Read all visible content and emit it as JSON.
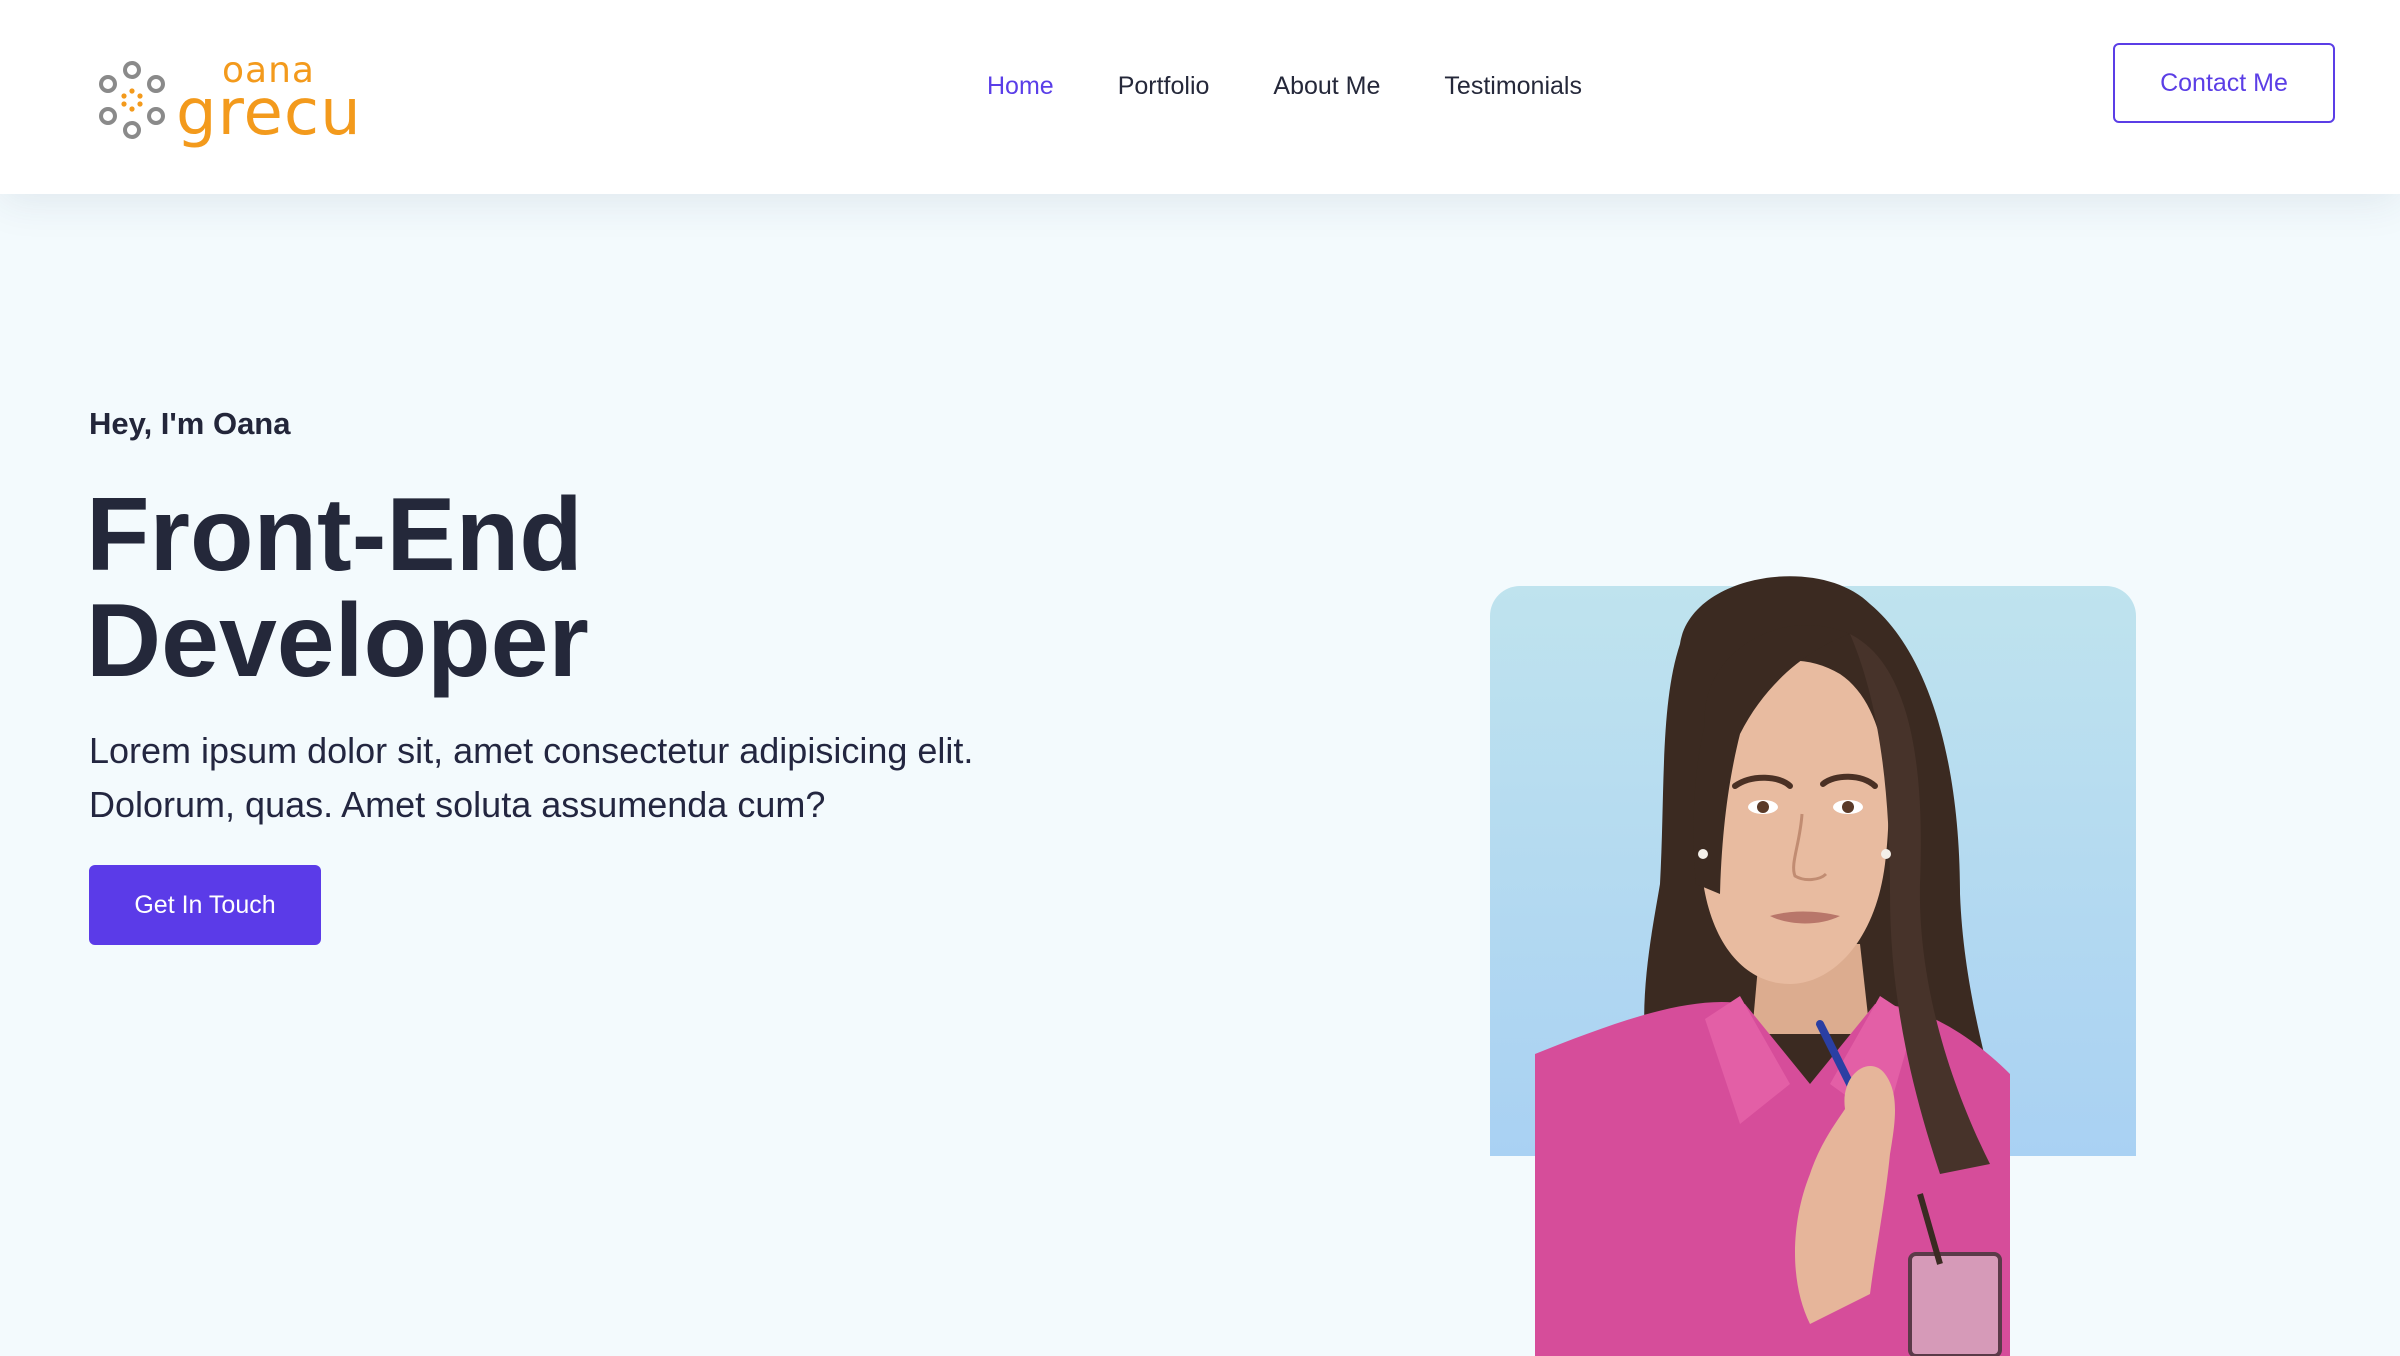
{
  "brand": {
    "first_name": "oana",
    "last_name": "grecu",
    "color": "#f39a1c",
    "mark_color": "#8a8a8a",
    "icon": "flower-dots-icon"
  },
  "nav": {
    "items": [
      {
        "label": "Home",
        "active": true
      },
      {
        "label": "Portfolio",
        "active": false
      },
      {
        "label": "About Me",
        "active": false
      },
      {
        "label": "Testimonials",
        "active": false
      }
    ],
    "active_color": "#5a3ee8"
  },
  "header": {
    "contact_label": "Contact Me"
  },
  "hero": {
    "greeting": "Hey, I'm Oana",
    "headline_line1": "Front-End",
    "headline_line2": "Developer",
    "lead_line1": "Lorem ipsum dolor sit, amet consectetur adipisicing elit.",
    "lead_line2": "Dolorum, quas. Amet soluta assumenda cum?",
    "cta_label": "Get In Touch",
    "accent": "#5b3be8",
    "background": "#f3fafd"
  },
  "portrait": {
    "description": "",
    "card_gradient": [
      "#bfe3ee",
      "#a9d1f3"
    ]
  }
}
